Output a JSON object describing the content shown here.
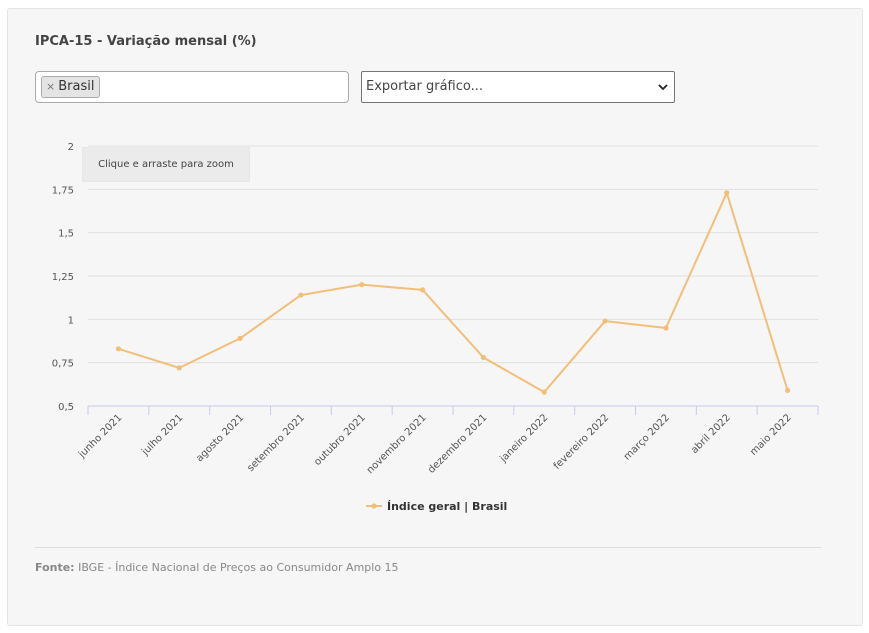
{
  "title": "IPCA-15 - Variação mensal (%)",
  "filter": {
    "tag_label": "Brasil",
    "remove_symbol": "×"
  },
  "export": {
    "label": "Exportar gráfico...",
    "icon": "chevron-down-icon"
  },
  "zoom_hint": "Clique e arraste para zoom",
  "colors": {
    "series": "#f2bf78",
    "grid": "#e0e0e0",
    "axis": "#c5cbe8"
  },
  "chart_data": {
    "type": "line",
    "categories": [
      "junho 2021",
      "julho 2021",
      "agosto 2021",
      "setembro 2021",
      "outubro 2021",
      "novembro 2021",
      "dezembro 2021",
      "janeiro 2022",
      "fevereiro 2022",
      "março 2022",
      "abril 2022",
      "maio 2022"
    ],
    "series": [
      {
        "name": "Índice geral | Brasil",
        "values": [
          0.83,
          0.72,
          0.89,
          1.14,
          1.2,
          1.17,
          0.78,
          0.58,
          0.99,
          0.95,
          1.73,
          0.59
        ]
      }
    ],
    "yticks": [
      "2",
      "1,75",
      "1,5",
      "1,25",
      "1",
      "0,75",
      "0,5"
    ],
    "ytick_values": [
      2,
      1.75,
      1.5,
      1.25,
      1,
      0.75,
      0.5
    ],
    "ylim": [
      0.5,
      2
    ],
    "grid": true,
    "legend_position": "bottom-center"
  },
  "source": {
    "label": "Fonte:",
    "text": "IBGE - Índice Nacional de Preços ao Consumidor Amplo 15"
  }
}
